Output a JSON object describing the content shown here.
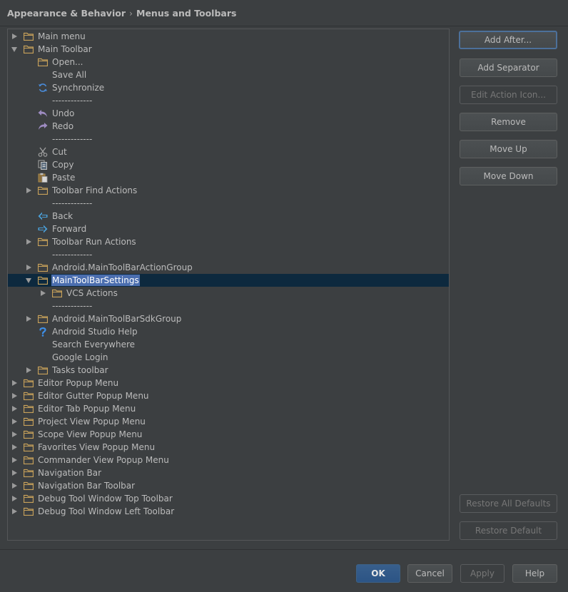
{
  "breadcrumb": {
    "section": "Appearance & Behavior",
    "separator": "›",
    "page": "Menus and Toolbars"
  },
  "colors": {
    "background": "#3c3f41",
    "selection_row": "#0d293e",
    "selection_label": "#4b6eaf",
    "folder": "#c7a15a",
    "undo_icon": "#9e8cc2",
    "sync_icon": "#4a8ad6",
    "help_icon": "#3d8fe8"
  },
  "tree": [
    {
      "label": "Main menu",
      "icon": "folder-icon",
      "arrow": "collapsed",
      "depth": 0
    },
    {
      "label": "Main Toolbar",
      "icon": "folder-icon",
      "arrow": "expanded",
      "depth": 0
    },
    {
      "label": "Open...",
      "icon": "folder-icon",
      "arrow": "none",
      "depth": 1
    },
    {
      "label": "Save All",
      "icon": "save-icon",
      "arrow": "none",
      "depth": 1
    },
    {
      "label": "Synchronize",
      "icon": "sync-icon",
      "arrow": "none",
      "depth": 1
    },
    {
      "label": "-------------",
      "icon": "none",
      "arrow": "none",
      "depth": 1
    },
    {
      "label": "Undo",
      "icon": "undo-icon",
      "arrow": "none",
      "depth": 1
    },
    {
      "label": "Redo",
      "icon": "redo-icon",
      "arrow": "none",
      "depth": 1
    },
    {
      "label": "-------------",
      "icon": "none",
      "arrow": "none",
      "depth": 1
    },
    {
      "label": "Cut",
      "icon": "cut-icon",
      "arrow": "none",
      "depth": 1
    },
    {
      "label": "Copy",
      "icon": "copy-icon",
      "arrow": "none",
      "depth": 1
    },
    {
      "label": "Paste",
      "icon": "paste-icon",
      "arrow": "none",
      "depth": 1
    },
    {
      "label": "Toolbar Find Actions",
      "icon": "folder-icon",
      "arrow": "collapsed",
      "depth": 1
    },
    {
      "label": "-------------",
      "icon": "none",
      "arrow": "none",
      "depth": 1
    },
    {
      "label": "Back",
      "icon": "back-icon",
      "arrow": "none",
      "depth": 1
    },
    {
      "label": "Forward",
      "icon": "forward-icon",
      "arrow": "none",
      "depth": 1
    },
    {
      "label": "Toolbar Run Actions",
      "icon": "folder-icon",
      "arrow": "collapsed",
      "depth": 1
    },
    {
      "label": "-------------",
      "icon": "none",
      "arrow": "none",
      "depth": 1
    },
    {
      "label": "Android.MainToolBarActionGroup",
      "icon": "folder-icon",
      "arrow": "collapsed",
      "depth": 1
    },
    {
      "label": "MainToolBarSettings",
      "icon": "folder-icon",
      "arrow": "expanded",
      "depth": 1,
      "selected": true
    },
    {
      "label": "VCS Actions",
      "icon": "folder-icon",
      "arrow": "collapsed",
      "depth": 2
    },
    {
      "label": "-------------",
      "icon": "none",
      "arrow": "none",
      "depth": 1
    },
    {
      "label": "Android.MainToolBarSdkGroup",
      "icon": "folder-icon",
      "arrow": "collapsed",
      "depth": 1
    },
    {
      "label": "Android Studio Help",
      "icon": "help-icon",
      "arrow": "none",
      "depth": 1
    },
    {
      "label": "Search Everywhere",
      "icon": "none",
      "arrow": "none",
      "depth": 1
    },
    {
      "label": "Google Login",
      "icon": "none",
      "arrow": "none",
      "depth": 1
    },
    {
      "label": "Tasks toolbar",
      "icon": "folder-icon",
      "arrow": "collapsed",
      "depth": 1
    },
    {
      "label": "Editor Popup Menu",
      "icon": "folder-icon",
      "arrow": "collapsed",
      "depth": 0
    },
    {
      "label": "Editor Gutter Popup Menu",
      "icon": "folder-icon",
      "arrow": "collapsed",
      "depth": 0
    },
    {
      "label": "Editor Tab Popup Menu",
      "icon": "folder-icon",
      "arrow": "collapsed",
      "depth": 0
    },
    {
      "label": "Project View Popup Menu",
      "icon": "folder-icon",
      "arrow": "collapsed",
      "depth": 0
    },
    {
      "label": "Scope View Popup Menu",
      "icon": "folder-icon",
      "arrow": "collapsed",
      "depth": 0
    },
    {
      "label": "Favorites View Popup Menu",
      "icon": "folder-icon",
      "arrow": "collapsed",
      "depth": 0
    },
    {
      "label": "Commander View Popup Menu",
      "icon": "folder-icon",
      "arrow": "collapsed",
      "depth": 0
    },
    {
      "label": "Navigation Bar",
      "icon": "folder-icon",
      "arrow": "collapsed",
      "depth": 0
    },
    {
      "label": "Navigation Bar Toolbar",
      "icon": "folder-icon",
      "arrow": "collapsed",
      "depth": 0
    },
    {
      "label": "Debug Tool Window Top Toolbar",
      "icon": "folder-icon",
      "arrow": "collapsed",
      "depth": 0
    },
    {
      "label": "Debug Tool Window Left Toolbar",
      "icon": "folder-icon",
      "arrow": "collapsed",
      "depth": 0
    }
  ],
  "buttons": {
    "add_after": "Add After...",
    "add_separator": "Add Separator",
    "edit_action_icon": "Edit Action Icon...",
    "remove": "Remove",
    "move_up": "Move Up",
    "move_down": "Move Down",
    "restore_all_defaults": "Restore All Defaults",
    "restore_default": "Restore Default"
  },
  "footer": {
    "ok": "OK",
    "cancel": "Cancel",
    "apply": "Apply",
    "help": "Help"
  }
}
